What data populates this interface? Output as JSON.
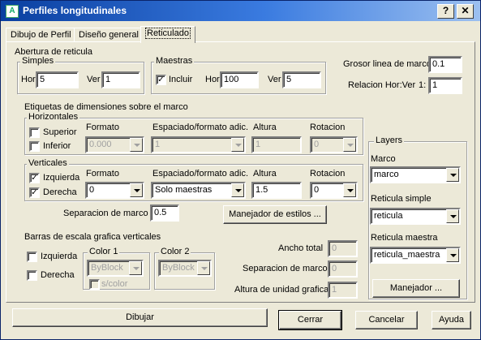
{
  "window": {
    "title": "Perfiles longitudinales",
    "help_btn": "?",
    "close_btn": "✕"
  },
  "tabs": [
    "Dibujo de Perfil",
    "Diseño general",
    "Reticulado"
  ],
  "abertura": {
    "title": "Abertura de reticula",
    "simples": {
      "title": "Simples",
      "hor_label": "Hor",
      "hor": "5",
      "ver_label": "Ver",
      "ver": "1"
    },
    "maestras": {
      "title": "Maestras",
      "incluir": "Incluir",
      "hor_label": "Hor",
      "hor": "100",
      "ver_label": "Ver",
      "ver": "5"
    }
  },
  "grosor": {
    "label": "Grosor linea de marco",
    "value": "0.1"
  },
  "relacion": {
    "label": "Relacion Hor:Ver",
    "prefix": "1:",
    "value": "1"
  },
  "etiquetas": {
    "title": "Etiquetas de dimensiones sobre el marco",
    "horizontales": {
      "title": "Horizontales",
      "superior": "Superior",
      "inferior": "Inferior",
      "formato_label": "Formato",
      "formato": "0.000",
      "espaciado_label": "Espaciado/formato adic.",
      "espaciado": "1",
      "altura_label": "Altura",
      "altura": "1",
      "rotacion_label": "Rotacion",
      "rotacion": "0"
    },
    "verticales": {
      "title": "Verticales",
      "izquierda": "Izquierda",
      "derecha": "Derecha",
      "formato_label": "Formato",
      "formato": "0",
      "espaciado_label": "Espaciado/formato adic.",
      "espaciado": "Solo maestras",
      "altura_label": "Altura",
      "altura": "1.5",
      "rotacion_label": "Rotacion",
      "rotacion": "0"
    },
    "separacion_label": "Separacion de marco",
    "separacion": "0.5",
    "manejador_estilos": "Manejador de estilos ..."
  },
  "barras": {
    "title": "Barras de escala grafica verticales",
    "izquierda": "Izquierda",
    "derecha": "Derecha",
    "color1_label": "Color 1",
    "color1": "ByBlock",
    "scolor": "s/color",
    "color2_label": "Color 2",
    "color2": "ByBlock",
    "ancho_label": "Ancho total",
    "ancho": "0",
    "separacion_label": "Separacion de marco",
    "separacion": "0",
    "altura_label": "Altura de unidad grafica",
    "altura": "1"
  },
  "layers": {
    "title": "Layers",
    "marco_label": "Marco",
    "marco": "marco",
    "simple_label": "Reticula simple",
    "simple": "reticula",
    "maestra_label": "Reticula maestra",
    "maestra": "reticula_maestra",
    "manejador": "Manejador ..."
  },
  "footer": {
    "dibujar": "Dibujar",
    "cerrar": "Cerrar",
    "cancelar": "Cancelar",
    "ayuda": "Ayuda"
  }
}
